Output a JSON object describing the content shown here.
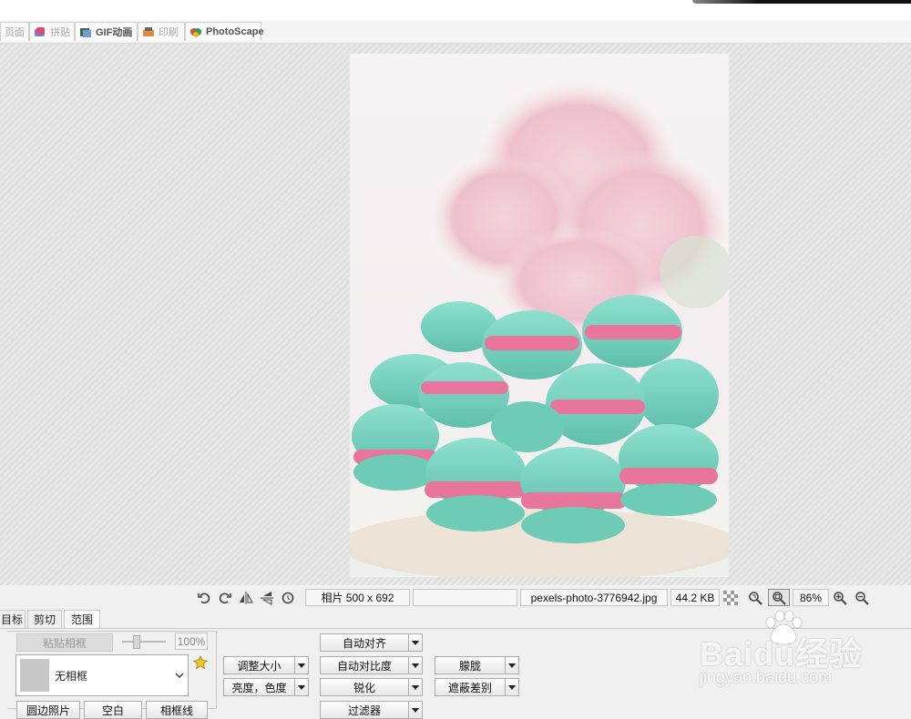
{
  "tabs": [
    {
      "label": "页面",
      "icon": "page-icon"
    },
    {
      "label": "拼贴",
      "icon": "combine-icon"
    },
    {
      "label": "GIF动画",
      "icon": "gif-icon"
    },
    {
      "label": "印刷",
      "icon": "print-icon"
    },
    {
      "label": "PhotoScape",
      "icon": "photoscape-icon"
    }
  ],
  "statusbar": {
    "image_size": "相片 500 x 692",
    "empty_field": "",
    "filename": "pexels-photo-3776942.jpg",
    "filesize": "44.2 KB",
    "zoom": "86%"
  },
  "panel": {
    "tabs": [
      "目标",
      "剪切",
      "范围"
    ],
    "paste_frame": "粘贴相框",
    "opacity": "100%",
    "frame_select": "无相框",
    "bottom_buttons": [
      "圆边照片",
      "空白",
      "相框线"
    ],
    "resize": "调整大小",
    "brightness": "亮度，色度",
    "auto_level": "自动对齐",
    "auto_contrast": "自动对比度",
    "sharpen": "锐化",
    "filter": "过滤器",
    "blur": "朦胧",
    "backlight": "遮蔽差别"
  },
  "watermark": {
    "brand": "Baidu经验",
    "url": "jingyan.baidu.com"
  },
  "colors": {
    "canvas_stripe": "#dedede",
    "macaron": "#7fd6c3",
    "filling": "#e8759c",
    "rose": "#f1c7d2"
  }
}
